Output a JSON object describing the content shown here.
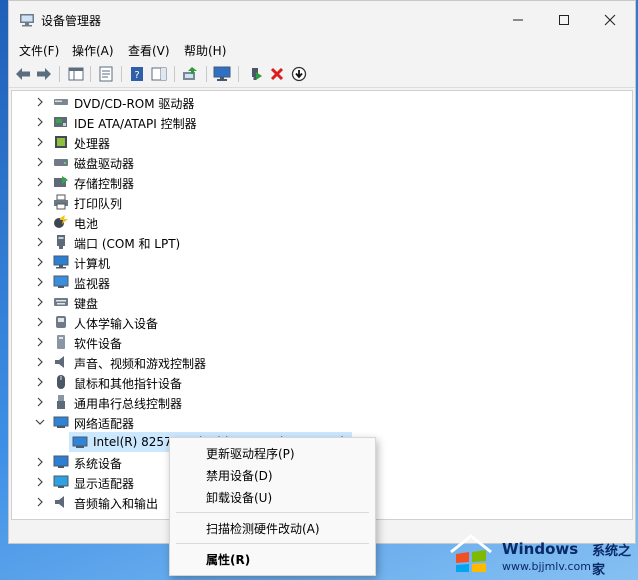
{
  "window": {
    "title": "设备管理器"
  },
  "menu": [
    "文件(F)",
    "操作(A)",
    "查看(V)",
    "帮助(H)"
  ],
  "tree": [
    {
      "label": "DVD/CD-ROM 驱动器",
      "icon": "dvd-drive-icon",
      "expanded": false
    },
    {
      "label": "IDE ATA/ATAPI 控制器",
      "icon": "ide-controller-icon",
      "expanded": false
    },
    {
      "label": "处理器",
      "icon": "processor-icon",
      "expanded": false
    },
    {
      "label": "磁盘驱动器",
      "icon": "disk-drive-icon",
      "expanded": false
    },
    {
      "label": "存储控制器",
      "icon": "storage-controller-icon",
      "expanded": false
    },
    {
      "label": "打印队列",
      "icon": "printer-icon",
      "expanded": false
    },
    {
      "label": "电池",
      "icon": "battery-icon",
      "expanded": false
    },
    {
      "label": "端口 (COM 和 LPT)",
      "icon": "port-icon",
      "expanded": false
    },
    {
      "label": "计算机",
      "icon": "computer-icon",
      "expanded": false
    },
    {
      "label": "监视器",
      "icon": "monitor-icon",
      "expanded": false
    },
    {
      "label": "键盘",
      "icon": "keyboard-icon",
      "expanded": false
    },
    {
      "label": "人体学输入设备",
      "icon": "hid-icon",
      "expanded": false
    },
    {
      "label": "软件设备",
      "icon": "software-device-icon",
      "expanded": false
    },
    {
      "label": "声音、视频和游戏控制器",
      "icon": "speaker-icon",
      "expanded": false
    },
    {
      "label": "鼠标和其他指针设备",
      "icon": "mouse-icon",
      "expanded": false
    },
    {
      "label": "通用串行总线控制器",
      "icon": "usb-icon",
      "expanded": false
    },
    {
      "label": "网络适配器",
      "icon": "network-adapter-icon",
      "expanded": true
    },
    {
      "label": "Intel(R) 82574L Gigabit Network Connection",
      "icon": "network-card-icon",
      "child": true,
      "selected": true
    },
    {
      "label": "系统设备",
      "icon": "system-device-icon",
      "expanded": false
    },
    {
      "label": "显示适配器",
      "icon": "display-adapter-icon",
      "expanded": false
    },
    {
      "label": "音频输入和输出",
      "icon": "audio-io-icon",
      "expanded": false
    }
  ],
  "context_menu": {
    "update_driver": "更新驱动程序(P)",
    "disable_device": "禁用设备(D)",
    "uninstall_device": "卸载设备(U)",
    "scan_hardware": "扫描检测硬件改动(A)",
    "properties": "属性(R)"
  },
  "watermark": {
    "brand": "Windows",
    "site_name": "系统之家",
    "url": "www.bjjmlv.com"
  },
  "colors": {
    "selection": "#cce8ff",
    "accent": "#0078d4",
    "delete_red": "#d81e1e"
  }
}
